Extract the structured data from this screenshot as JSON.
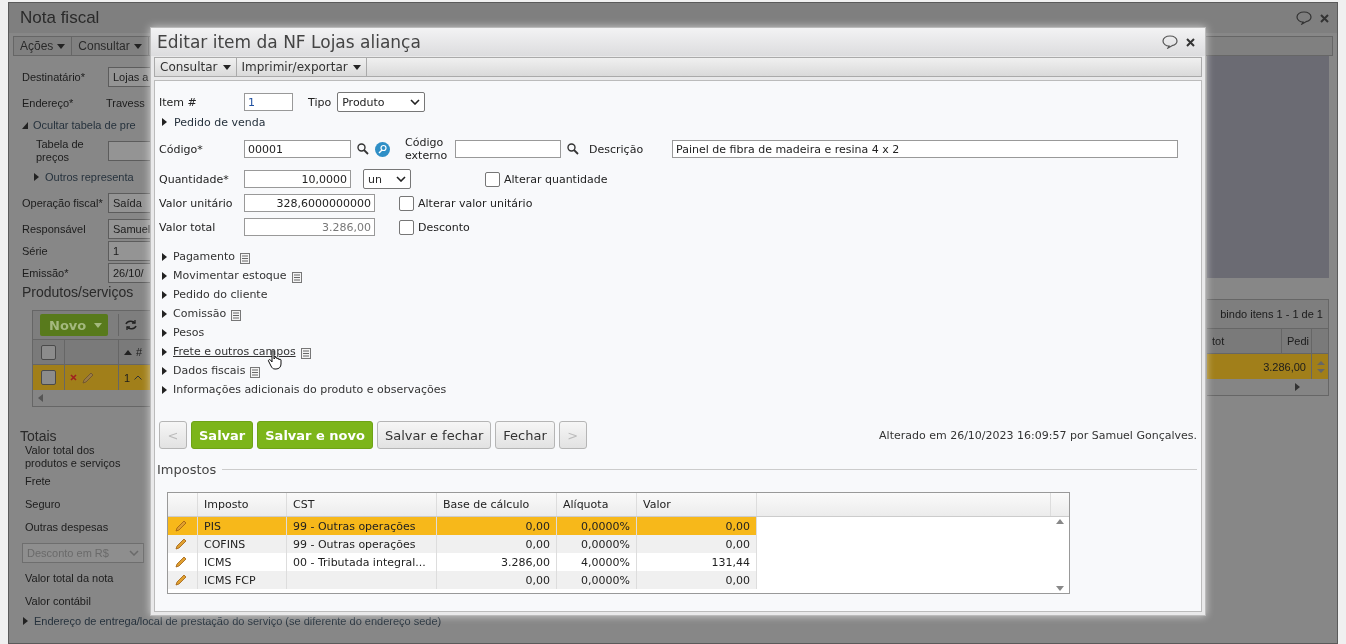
{
  "background_window": {
    "title": "Nota fiscal",
    "menu": [
      {
        "label": "Ações"
      },
      {
        "label": "Consultar"
      }
    ],
    "form": [
      {
        "kind": "field",
        "label": "Destinatário*",
        "value": "Lojas a"
      },
      {
        "kind": "text",
        "label": "Endereço*",
        "value": "Travess"
      },
      {
        "kind": "toggle",
        "label": "Ocultar tabela de pre",
        "expanded": true
      },
      {
        "kind": "field",
        "label": "Tabela de preços",
        "indent": true
      },
      {
        "kind": "toggle",
        "label": "Outros representa",
        "expanded": false,
        "indent": true
      },
      {
        "kind": "field",
        "label": "Operação fiscal*",
        "value": "Saída"
      },
      {
        "kind": "field",
        "label": "Responsável",
        "value": "Samuel"
      },
      {
        "kind": "field",
        "label": "Série",
        "value": "1"
      },
      {
        "kind": "field",
        "label": "Emissão*",
        "value": "26/10/"
      }
    ],
    "products": {
      "title": "Produtos/serviços",
      "new_button": "Novo",
      "paging": "bindo itens 1 - 1 de 1",
      "header_checked": false,
      "sort_column": "#",
      "right_columns": [
        "tot",
        "Pedi"
      ],
      "rows": [
        {
          "selected": true,
          "checked": false,
          "number": "1",
          "total": "3.286,00"
        }
      ]
    },
    "totals": {
      "title": "Totais",
      "rows": [
        {
          "kind": "label",
          "label": "Valor total dos produtos e serviços"
        },
        {
          "kind": "label",
          "label": "Frete"
        },
        {
          "kind": "label",
          "label": "Seguro"
        },
        {
          "kind": "label",
          "label": "Outras despesas"
        },
        {
          "kind": "select",
          "label": "Desconto em R$"
        },
        {
          "kind": "label",
          "label": "Valor total da nota"
        },
        {
          "kind": "label",
          "label": "Valor contábil"
        }
      ]
    },
    "footer_sections": [
      {
        "label": "Endereço de entrega/local de prestação do serviço (se diferente do endereço sede)",
        "expanded": false
      }
    ]
  },
  "dialog": {
    "title": "Editar item da NF Lojas aliança",
    "menu": [
      {
        "label": "Consultar"
      },
      {
        "label": "Imprimir/exportar"
      }
    ],
    "item": {
      "label": "Item #",
      "value": "1"
    },
    "type": {
      "label": "Tipo",
      "value": "Produto"
    },
    "sales_order": {
      "label": "Pedido de venda",
      "expanded": false
    },
    "code": {
      "label": "Código*",
      "value": "00001"
    },
    "external_code": {
      "label": "Código externo"
    },
    "description": {
      "label": "Descrição",
      "value": "Painel de fibra de madeira e resina 4 x 2"
    },
    "quantity": {
      "label": "Quantidade*",
      "value": "10,0000",
      "unit": "un"
    },
    "unit_value": {
      "label": "Valor unitário",
      "value": "328,6000000000"
    },
    "total_value": {
      "label": "Valor total",
      "value": "3.286,00",
      "disabled": true
    },
    "checkboxes": [
      {
        "label": "Alterar quantidade",
        "checked": false
      },
      {
        "label": "Alterar valor unitário",
        "checked": false
      },
      {
        "label": "Desconto",
        "checked": false
      }
    ],
    "sections": [
      {
        "label": "Pagamento",
        "expanded": false,
        "has_notes": true,
        "hovered": false
      },
      {
        "label": "Movimentar estoque",
        "expanded": false,
        "has_notes": true,
        "hovered": false
      },
      {
        "label": "Pedido do cliente",
        "expanded": false,
        "has_notes": false,
        "hovered": false
      },
      {
        "label": "Comissão",
        "expanded": false,
        "has_notes": true,
        "hovered": false
      },
      {
        "label": "Pesos",
        "expanded": false,
        "has_notes": false,
        "hovered": false
      },
      {
        "label": "Frete e outros campos",
        "expanded": false,
        "has_notes": true,
        "hovered": true
      },
      {
        "label": "Dados fiscais",
        "expanded": false,
        "has_notes": true,
        "hovered": false
      },
      {
        "label": "Informações adicionais do produto e observações",
        "expanded": false,
        "has_notes": false,
        "hovered": false
      }
    ],
    "buttons": [
      {
        "label": "<",
        "kind": "nav",
        "disabled": true
      },
      {
        "label": "Salvar",
        "kind": "primary",
        "disabled": false
      },
      {
        "label": "Salvar e novo",
        "kind": "primary",
        "disabled": false
      },
      {
        "label": "Salvar e fechar",
        "kind": "secondary",
        "disabled": false
      },
      {
        "label": "Fechar",
        "kind": "secondary",
        "disabled": false
      },
      {
        "label": ">",
        "kind": "nav",
        "disabled": true
      }
    ],
    "modified": "Alterado em 26/10/2023 16:09:57 por Samuel Gonçalves.",
    "taxes": {
      "title": "Impostos",
      "columns": [
        "Imposto",
        "CST",
        "Base de cálculo",
        "Alíquota",
        "Valor"
      ],
      "rows": [
        {
          "selected": true,
          "cells": [
            "PIS",
            "99 - Outras operações",
            "0,00",
            "0,0000%",
            "0,00"
          ]
        },
        {
          "selected": false,
          "cells": [
            "COFINS",
            "99 - Outras operações",
            "0,00",
            "0,0000%",
            "0,00"
          ]
        },
        {
          "selected": false,
          "cells": [
            "ICMS",
            "00 - Tributada integral...",
            "3.286,00",
            "4,0000%",
            "131,44"
          ]
        },
        {
          "selected": false,
          "cells": [
            "ICMS FCP",
            "",
            "0,00",
            "0,0000%",
            "0,00"
          ]
        }
      ]
    }
  }
}
